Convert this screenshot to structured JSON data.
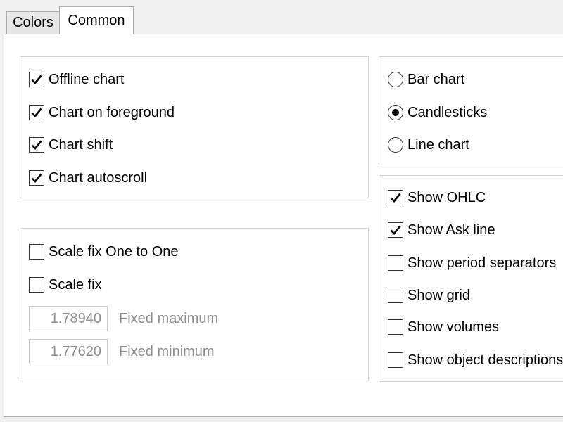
{
  "tabs": {
    "colors": "Colors",
    "common": "Common"
  },
  "chart_options": [
    {
      "label": "Offline chart",
      "checked": true
    },
    {
      "label": "Chart on foreground",
      "checked": true
    },
    {
      "label": "Chart shift",
      "checked": true
    },
    {
      "label": "Chart autoscroll",
      "checked": true
    }
  ],
  "scale": {
    "fix_one_to_one": {
      "label": "Scale fix One to One",
      "checked": false
    },
    "fix": {
      "label": "Scale fix",
      "checked": false
    },
    "fixed_maximum": {
      "value": "1.78940",
      "label": "Fixed maximum"
    },
    "fixed_minimum": {
      "value": "1.77620",
      "label": "Fixed minimum"
    }
  },
  "chart_type": {
    "selected": "Candlesticks",
    "options": [
      "Bar chart",
      "Candlesticks",
      "Line chart"
    ]
  },
  "show_options": [
    {
      "label": "Show OHLC",
      "checked": true
    },
    {
      "label": "Show Ask line",
      "checked": true
    },
    {
      "label": "Show period separators",
      "checked": false
    },
    {
      "label": "Show grid",
      "checked": false
    },
    {
      "label": "Show volumes",
      "checked": false
    },
    {
      "label": "Show object descriptions",
      "checked": false
    }
  ]
}
